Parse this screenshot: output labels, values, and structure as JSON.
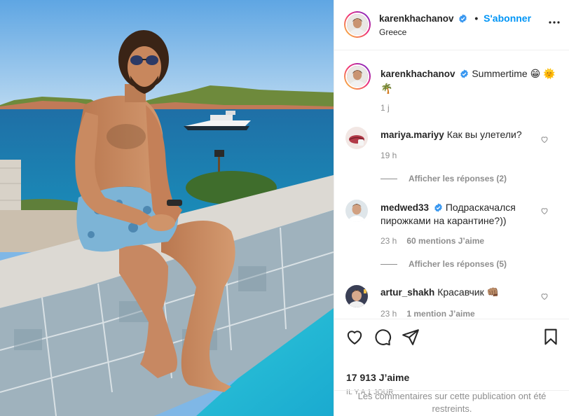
{
  "post": {
    "author": "karenkhachanov",
    "location": "Greece",
    "follow_label": "S'abonner",
    "separator": "•"
  },
  "caption": {
    "author": "karenkhachanov",
    "text": "Summertime 😁 🌞🌴",
    "time": "1 j"
  },
  "comments": [
    {
      "author": "mariya.mariyy",
      "text": "Как вы улетели?",
      "time": "19 h",
      "likes": "",
      "replies": "Afficher les réponses (2)",
      "verified": false
    },
    {
      "author": "medwed33",
      "text": "Подраскачался пирожками на карантине?))",
      "time": "23 h",
      "likes": "60 mentions J’aime",
      "replies": "Afficher les réponses (5)",
      "verified": true
    },
    {
      "author": "artur_shakh",
      "text": "Красавчик 👊🏽",
      "time": "23 h",
      "likes": "1 mention J’aime",
      "replies": "",
      "verified": false
    }
  ],
  "footer": {
    "likes": "17 913 J’aime",
    "posted_ago": "IL Y A 1 JOUR",
    "restricted_notice": "Les commentaires sur cette publication ont été restreints."
  },
  "colors": {
    "link": "#0095f6",
    "verified": "#3897f0",
    "muted": "#8e8e8e",
    "text": "#262626"
  },
  "icons": {
    "more": "more-icon",
    "like": "heart-icon",
    "comment": "comment-icon",
    "share": "share-icon",
    "save": "bookmark-icon"
  }
}
